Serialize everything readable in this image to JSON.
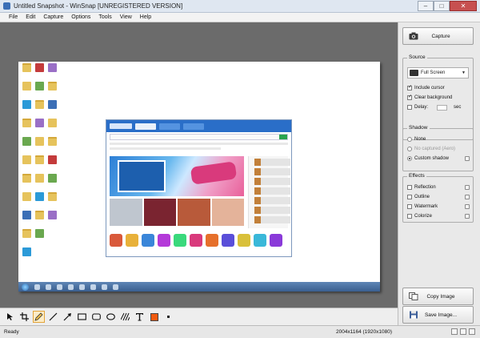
{
  "window": {
    "title": "Untitled Snapshot - WinSnap  [UNREGISTERED VERSION]",
    "controls": [
      "–",
      "□",
      "✕"
    ]
  },
  "menu": [
    "File",
    "Edit",
    "Capture",
    "Options",
    "Tools",
    "View",
    "Help"
  ],
  "sidebar": {
    "capture_label": "Capture",
    "source": {
      "title": "Source",
      "mode": "Full Screen",
      "include_cursor": {
        "label": "Include cursor",
        "checked": true
      },
      "clear_background": {
        "label": "Clear background",
        "checked": true
      },
      "delay": {
        "label": "Delay:",
        "unit": "sec",
        "checked": false
      }
    },
    "shadow": {
      "title": "Shadow",
      "options": [
        {
          "label": "None",
          "selected": false,
          "enabled": true
        },
        {
          "label": "No captured (Aero)",
          "selected": false,
          "enabled": false
        },
        {
          "label": "Custom shadow",
          "selected": true,
          "enabled": true
        }
      ]
    },
    "effects": {
      "title": "Effects",
      "items": [
        {
          "label": "Reflection",
          "checked": false
        },
        {
          "label": "Outline",
          "checked": false
        },
        {
          "label": "Watermark",
          "checked": false
        },
        {
          "label": "Colorize",
          "checked": false
        }
      ]
    },
    "copy_label": "Copy Image",
    "save_label": "Save Image..."
  },
  "tools": [
    "pointer-icon",
    "crop-icon",
    "pen-icon",
    "line-icon",
    "arrow-icon",
    "rectangle-icon",
    "rounded-rectangle-icon",
    "ellipse-icon",
    "hatch-icon",
    "text-icon"
  ],
  "colors": {
    "accent_swatch": "#f05a10"
  },
  "status": {
    "left": "Ready",
    "dimensions": "2004x1164 (1920x1080)"
  }
}
